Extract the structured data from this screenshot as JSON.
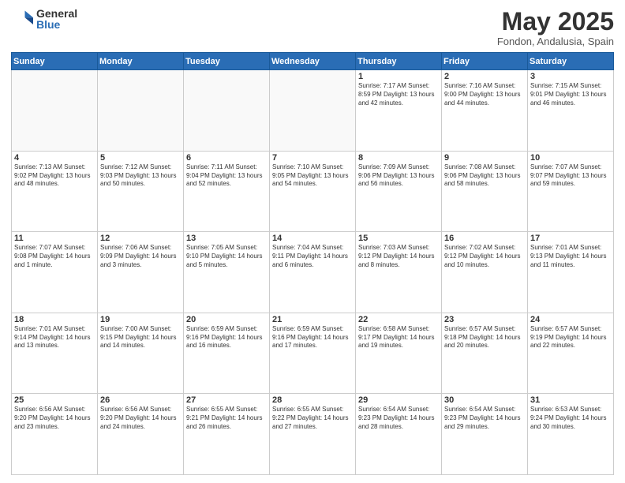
{
  "header": {
    "logo_general": "General",
    "logo_blue": "Blue",
    "month": "May 2025",
    "location": "Fondon, Andalusia, Spain"
  },
  "days_of_week": [
    "Sunday",
    "Monday",
    "Tuesday",
    "Wednesday",
    "Thursday",
    "Friday",
    "Saturday"
  ],
  "weeks": [
    [
      {
        "day": "",
        "info": ""
      },
      {
        "day": "",
        "info": ""
      },
      {
        "day": "",
        "info": ""
      },
      {
        "day": "",
        "info": ""
      },
      {
        "day": "1",
        "info": "Sunrise: 7:17 AM\nSunset: 8:59 PM\nDaylight: 13 hours\nand 42 minutes."
      },
      {
        "day": "2",
        "info": "Sunrise: 7:16 AM\nSunset: 9:00 PM\nDaylight: 13 hours\nand 44 minutes."
      },
      {
        "day": "3",
        "info": "Sunrise: 7:15 AM\nSunset: 9:01 PM\nDaylight: 13 hours\nand 46 minutes."
      }
    ],
    [
      {
        "day": "4",
        "info": "Sunrise: 7:13 AM\nSunset: 9:02 PM\nDaylight: 13 hours\nand 48 minutes."
      },
      {
        "day": "5",
        "info": "Sunrise: 7:12 AM\nSunset: 9:03 PM\nDaylight: 13 hours\nand 50 minutes."
      },
      {
        "day": "6",
        "info": "Sunrise: 7:11 AM\nSunset: 9:04 PM\nDaylight: 13 hours\nand 52 minutes."
      },
      {
        "day": "7",
        "info": "Sunrise: 7:10 AM\nSunset: 9:05 PM\nDaylight: 13 hours\nand 54 minutes."
      },
      {
        "day": "8",
        "info": "Sunrise: 7:09 AM\nSunset: 9:06 PM\nDaylight: 13 hours\nand 56 minutes."
      },
      {
        "day": "9",
        "info": "Sunrise: 7:08 AM\nSunset: 9:06 PM\nDaylight: 13 hours\nand 58 minutes."
      },
      {
        "day": "10",
        "info": "Sunrise: 7:07 AM\nSunset: 9:07 PM\nDaylight: 13 hours\nand 59 minutes."
      }
    ],
    [
      {
        "day": "11",
        "info": "Sunrise: 7:07 AM\nSunset: 9:08 PM\nDaylight: 14 hours\nand 1 minute."
      },
      {
        "day": "12",
        "info": "Sunrise: 7:06 AM\nSunset: 9:09 PM\nDaylight: 14 hours\nand 3 minutes."
      },
      {
        "day": "13",
        "info": "Sunrise: 7:05 AM\nSunset: 9:10 PM\nDaylight: 14 hours\nand 5 minutes."
      },
      {
        "day": "14",
        "info": "Sunrise: 7:04 AM\nSunset: 9:11 PM\nDaylight: 14 hours\nand 6 minutes."
      },
      {
        "day": "15",
        "info": "Sunrise: 7:03 AM\nSunset: 9:12 PM\nDaylight: 14 hours\nand 8 minutes."
      },
      {
        "day": "16",
        "info": "Sunrise: 7:02 AM\nSunset: 9:12 PM\nDaylight: 14 hours\nand 10 minutes."
      },
      {
        "day": "17",
        "info": "Sunrise: 7:01 AM\nSunset: 9:13 PM\nDaylight: 14 hours\nand 11 minutes."
      }
    ],
    [
      {
        "day": "18",
        "info": "Sunrise: 7:01 AM\nSunset: 9:14 PM\nDaylight: 14 hours\nand 13 minutes."
      },
      {
        "day": "19",
        "info": "Sunrise: 7:00 AM\nSunset: 9:15 PM\nDaylight: 14 hours\nand 14 minutes."
      },
      {
        "day": "20",
        "info": "Sunrise: 6:59 AM\nSunset: 9:16 PM\nDaylight: 14 hours\nand 16 minutes."
      },
      {
        "day": "21",
        "info": "Sunrise: 6:59 AM\nSunset: 9:16 PM\nDaylight: 14 hours\nand 17 minutes."
      },
      {
        "day": "22",
        "info": "Sunrise: 6:58 AM\nSunset: 9:17 PM\nDaylight: 14 hours\nand 19 minutes."
      },
      {
        "day": "23",
        "info": "Sunrise: 6:57 AM\nSunset: 9:18 PM\nDaylight: 14 hours\nand 20 minutes."
      },
      {
        "day": "24",
        "info": "Sunrise: 6:57 AM\nSunset: 9:19 PM\nDaylight: 14 hours\nand 22 minutes."
      }
    ],
    [
      {
        "day": "25",
        "info": "Sunrise: 6:56 AM\nSunset: 9:20 PM\nDaylight: 14 hours\nand 23 minutes."
      },
      {
        "day": "26",
        "info": "Sunrise: 6:56 AM\nSunset: 9:20 PM\nDaylight: 14 hours\nand 24 minutes."
      },
      {
        "day": "27",
        "info": "Sunrise: 6:55 AM\nSunset: 9:21 PM\nDaylight: 14 hours\nand 26 minutes."
      },
      {
        "day": "28",
        "info": "Sunrise: 6:55 AM\nSunset: 9:22 PM\nDaylight: 14 hours\nand 27 minutes."
      },
      {
        "day": "29",
        "info": "Sunrise: 6:54 AM\nSunset: 9:23 PM\nDaylight: 14 hours\nand 28 minutes."
      },
      {
        "day": "30",
        "info": "Sunrise: 6:54 AM\nSunset: 9:23 PM\nDaylight: 14 hours\nand 29 minutes."
      },
      {
        "day": "31",
        "info": "Sunrise: 6:53 AM\nSunset: 9:24 PM\nDaylight: 14 hours\nand 30 minutes."
      }
    ]
  ]
}
